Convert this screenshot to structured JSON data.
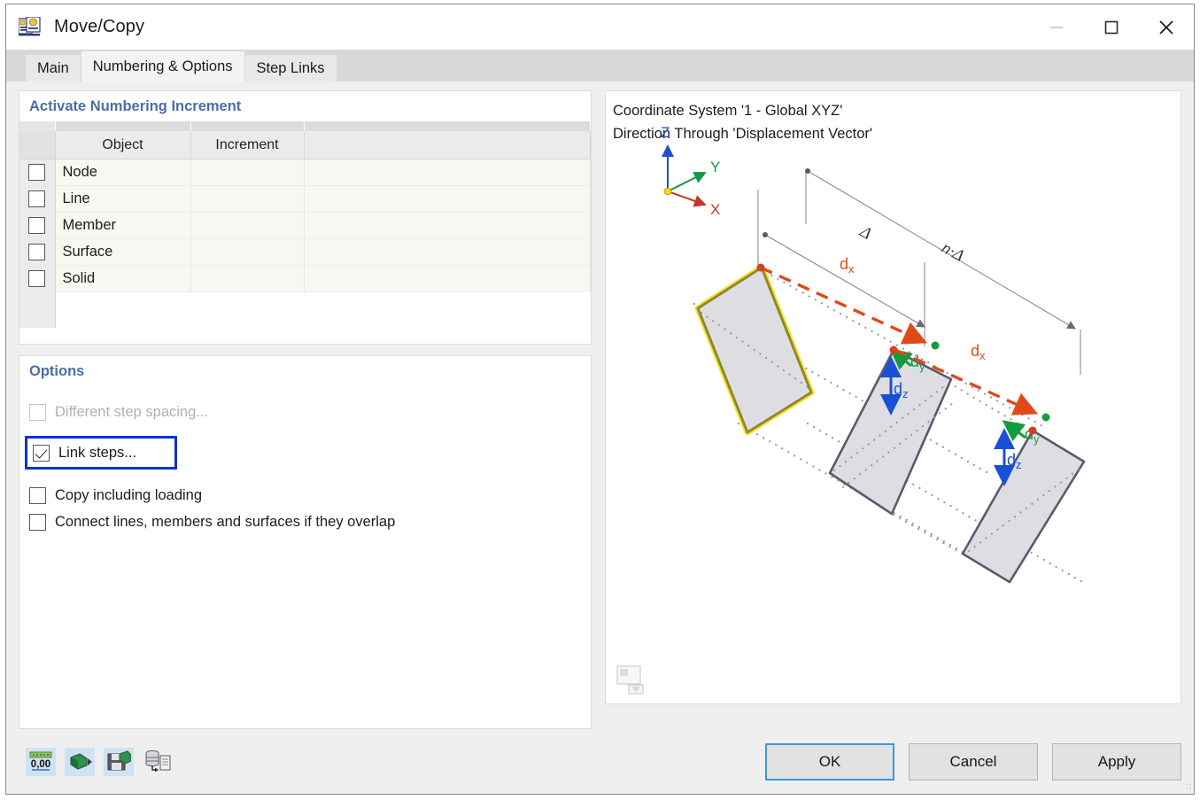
{
  "window": {
    "title": "Move/Copy",
    "icon": "move-copy-icon",
    "minimize_label": "—",
    "maximize_label": "□",
    "close_label": "✕"
  },
  "tabs": [
    {
      "label": "Main",
      "active": false
    },
    {
      "label": "Numbering & Options",
      "active": true
    },
    {
      "label": "Step Links",
      "active": false
    }
  ],
  "numbering": {
    "title": "Activate Numbering Increment",
    "columns": [
      "Object",
      "Increment"
    ],
    "rows": [
      {
        "object": "Node",
        "increment": "",
        "checked": false
      },
      {
        "object": "Line",
        "increment": "",
        "checked": false
      },
      {
        "object": "Member",
        "increment": "",
        "checked": false
      },
      {
        "object": "Surface",
        "increment": "",
        "checked": false
      },
      {
        "object": "Solid",
        "increment": "",
        "checked": false
      }
    ]
  },
  "options": {
    "title": "Options",
    "items": [
      {
        "label": "Different step spacing...",
        "checked": false,
        "disabled": true,
        "focused": false
      },
      {
        "label": "Link steps...",
        "checked": true,
        "disabled": false,
        "focused": true
      },
      {
        "label": "Copy including loading",
        "checked": false,
        "disabled": false,
        "focused": false
      },
      {
        "label": "Connect lines, members and surfaces if they overlap",
        "checked": false,
        "disabled": false,
        "focused": false
      }
    ]
  },
  "graphics": {
    "caption_line1": "Coordinate System '1 - Global XYZ'",
    "caption_line2": "Direction Through 'Displacement Vector'",
    "axis_labels": {
      "x": "X",
      "y": "Y",
      "z": "Z"
    },
    "dimension_labels": {
      "delta": "Δ",
      "n_delta": "n·Δ"
    },
    "vector_labels": {
      "dx": "d",
      "dx_sub": "x",
      "dy": "d",
      "dy_sub": "y",
      "dz": "d",
      "dz_sub": "z"
    },
    "thumb_icon": "image-preview-icon"
  },
  "footer": {
    "tools": [
      {
        "name": "default-values-icon",
        "label": "0,00"
      },
      {
        "name": "apply-settings-icon",
        "label": ""
      },
      {
        "name": "save-settings-icon",
        "label": ""
      },
      {
        "name": "import-settings-icon",
        "label": ""
      }
    ],
    "buttons": [
      {
        "label": "OK",
        "default": true
      },
      {
        "label": "Cancel",
        "default": false
      },
      {
        "label": "Apply",
        "default": false
      }
    ]
  },
  "colors": {
    "accent_blue": "#4b6ea9",
    "focus_blue": "#0a31d8",
    "default_button_border": "#3b97e3",
    "axis_x": "#c0392b",
    "axis_y": "#119944",
    "axis_z": "#1f4fd0",
    "vector_dx": "#e04a1a",
    "vector_dy": "#149c3c",
    "vector_dz": "#1a4fd8",
    "source_outline": "#8c8a2a",
    "source_glow": "#f5e53a",
    "copy_outline": "#5a5a6e",
    "copy_fill": "#dcdce0"
  }
}
